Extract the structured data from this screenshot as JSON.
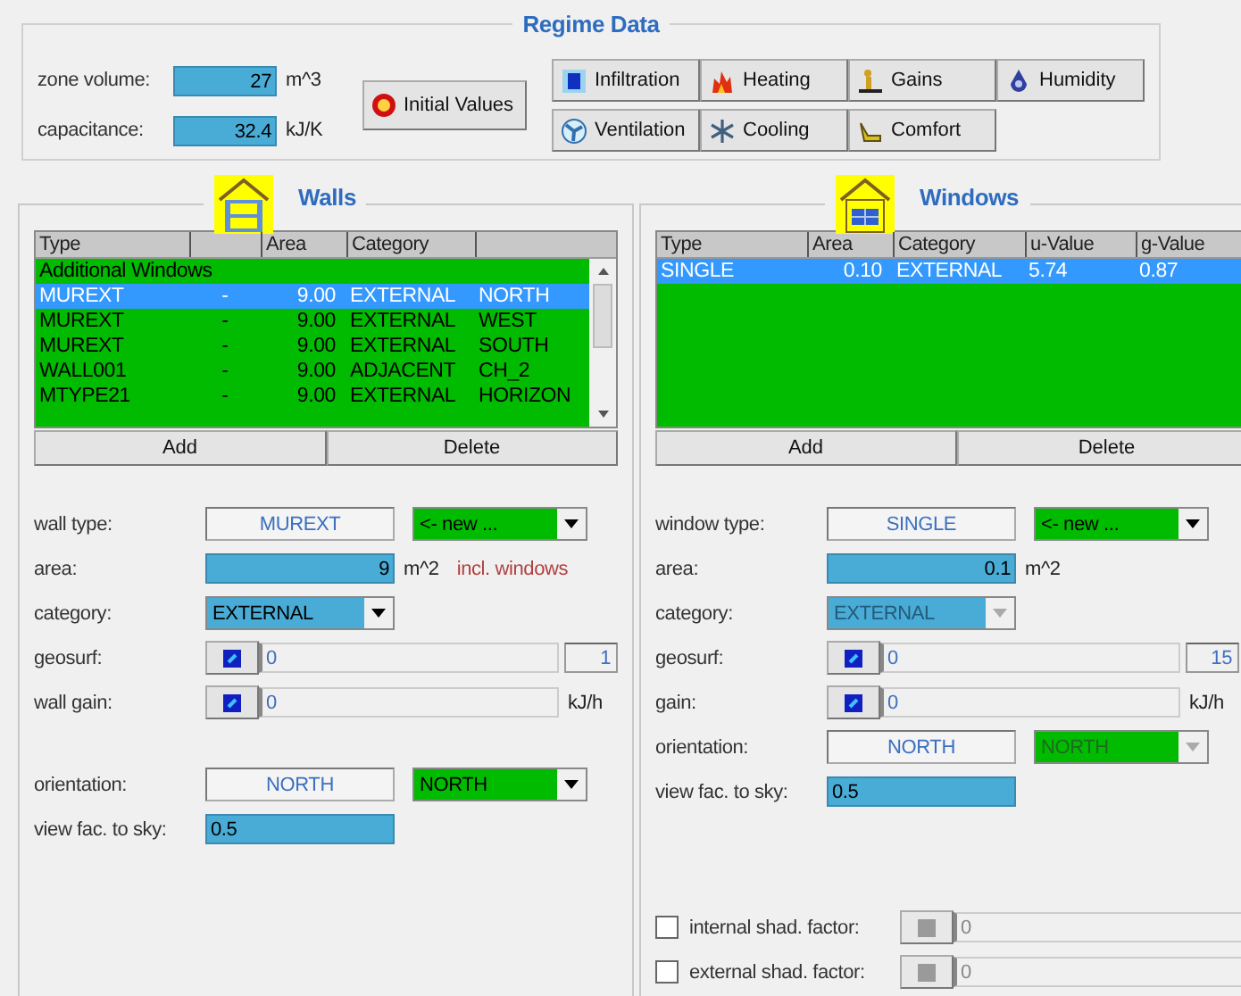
{
  "regime": {
    "title": "Regime Data",
    "fields": [
      {
        "label": "zone volume:",
        "value": "27",
        "unit": "m^3"
      },
      {
        "label": "capacitance:",
        "value": "32.4",
        "unit": "kJ/K"
      }
    ],
    "initial_button": "Initial Values",
    "buttons": [
      "Infiltration",
      "Heating",
      "Gains",
      "Humidity",
      "Ventilation",
      "Cooling",
      "Comfort"
    ]
  },
  "panels": [
    {
      "title": "Walls",
      "columns": [
        {
          "label": "Type"
        },
        {},
        {
          "label": "Area"
        },
        {
          "label": "Category"
        },
        {}
      ],
      "rows": [
        {
          "kind": "group",
          "cells": [
            "Additional Windows"
          ],
          "selected": false
        },
        {
          "kind": "item",
          "cells": [
            "MUREXT",
            "-",
            "9.00",
            "EXTERNAL",
            "NORTH"
          ],
          "selected": true
        },
        {
          "kind": "item",
          "cells": [
            "MUREXT",
            "-",
            "9.00",
            "EXTERNAL",
            "WEST"
          ],
          "selected": false
        },
        {
          "kind": "item",
          "cells": [
            "MUREXT",
            "-",
            "9.00",
            "EXTERNAL",
            "SOUTH"
          ],
          "selected": false
        },
        {
          "kind": "item",
          "cells": [
            "WALL001",
            "-",
            "9.00",
            "ADJACENT",
            "CH_2"
          ],
          "selected": false
        },
        {
          "kind": "item",
          "cells": [
            "MTYPE21",
            "-",
            "9.00",
            "EXTERNAL",
            "HORIZON"
          ],
          "selected": false
        }
      ],
      "buttons": [
        "Add",
        "Delete"
      ],
      "form": [
        {
          "kind": "type",
          "label": "wall type:",
          "value": "MUREXT",
          "combo": {
            "value": "<- new ...",
            "disabled": false
          }
        },
        {
          "kind": "number",
          "label": "area:",
          "value": "9",
          "unit": "m^2",
          "note": "incl. windows"
        },
        {
          "kind": "combo",
          "label": "category:",
          "combo": {
            "value": "EXTERNAL",
            "disabled": false
          }
        },
        {
          "kind": "file",
          "label": "geosurf:",
          "value": "0",
          "count": "1"
        },
        {
          "kind": "file",
          "label": "wall gain:",
          "value": "0",
          "unit": "kJ/h"
        },
        {
          "kind": "gap"
        },
        {
          "kind": "type",
          "label": "orientation:",
          "value": "NORTH",
          "combo": {
            "value": "NORTH",
            "disabled": false
          }
        },
        {
          "kind": "input",
          "label": "view fac. to sky:",
          "value": "0.5"
        }
      ]
    },
    {
      "title": "Windows",
      "columns": [
        {
          "label": "Type"
        },
        {
          "label": "Area"
        },
        {
          "label": "Category"
        },
        {
          "label": "u-Value"
        },
        {
          "label": "g-Value"
        }
      ],
      "rows": [
        {
          "kind": "item",
          "cells": [
            "SINGLE",
            "0.10",
            "EXTERNAL",
            "5.74",
            "0.87"
          ],
          "selected": true
        }
      ],
      "buttons": [
        "Add",
        "Delete"
      ],
      "form": [
        {
          "kind": "type",
          "label": "window type:",
          "value": "SINGLE",
          "combo": {
            "value": "<- new ...",
            "disabled": false
          }
        },
        {
          "kind": "number",
          "label": "area:",
          "value": "0.1",
          "unit": "m^2"
        },
        {
          "kind": "combo",
          "label": "category:",
          "combo": {
            "value": "EXTERNAL",
            "disabled": true
          }
        },
        {
          "kind": "file",
          "label": "geosurf:",
          "value": "0",
          "count": "15"
        },
        {
          "kind": "file",
          "label": "gain:",
          "value": "0",
          "unit": "kJ/h"
        },
        {
          "kind": "type",
          "label": "orientation:",
          "value": "NORTH",
          "combo": {
            "value": "NORTH",
            "disabled": true
          }
        },
        {
          "kind": "input",
          "label": "view fac. to sky:",
          "value": "0.5"
        },
        {
          "kind": "bigGap"
        },
        {
          "kind": "check",
          "label": "internal shad. factor:",
          "checked": false,
          "value": "0"
        },
        {
          "kind": "check",
          "label": "external shad. factor:",
          "checked": false,
          "value": "0"
        }
      ]
    }
  ]
}
